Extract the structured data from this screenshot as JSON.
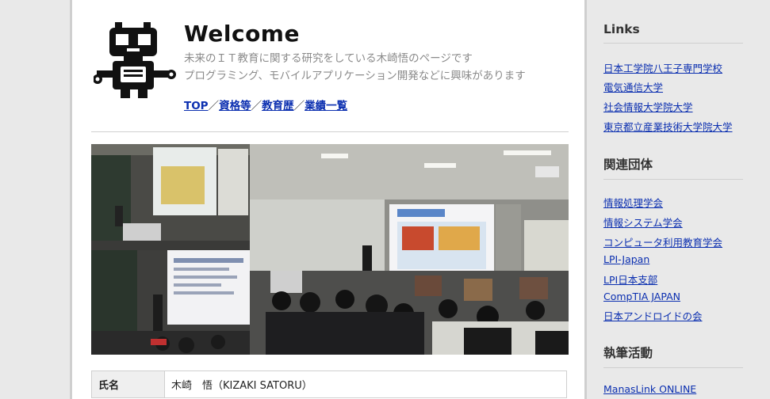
{
  "header": {
    "title": "Welcome",
    "subtitle_line1": "未来のＩＴ教育に関する研究をしている木崎悟のページです",
    "subtitle_line2": "プログラミング、モバイルアプリケーション開発などに興味があります"
  },
  "nav": {
    "items": [
      "TOP",
      "資格等",
      "教育歴",
      "業績一覧"
    ],
    "separator": "／"
  },
  "profile_table": {
    "rows": [
      {
        "label": "氏名",
        "value": "木崎　悟（KIZAKI SATORU）"
      }
    ]
  },
  "sidebar": {
    "sections": [
      {
        "heading": "Links",
        "links": [
          "日本工学院八王子専門学校",
          "電気通信大学",
          "社会情報大学院大学",
          "東京都立産業技術大学院大学"
        ]
      },
      {
        "heading": "関連団体",
        "links": [
          "情報処理学会",
          "情報システム学会",
          "コンピュータ利用教育学会",
          "LPI-Japan",
          "LPI日本支部",
          "CompTIA JAPAN",
          "日本アンドロイドの会"
        ]
      },
      {
        "heading": "執筆活動",
        "links": [
          "ManasLink ONLINE"
        ]
      }
    ]
  },
  "colors": {
    "page_bg": "#e9e9e9",
    "link": "#0b2fb0",
    "subtitle": "#8a8a8a"
  },
  "icons": {
    "logo": "robot-icon"
  }
}
